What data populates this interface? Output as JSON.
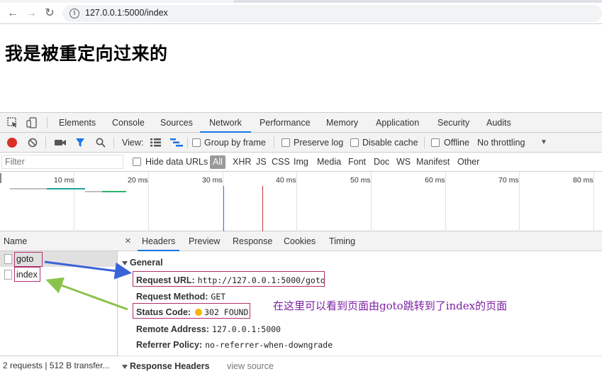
{
  "browser": {
    "url": "127.0.0.1:5000/index",
    "back_icon": "arrow-left-icon",
    "forward_icon": "arrow-right-icon",
    "reload_icon": "reload-icon",
    "info_icon": "info-icon"
  },
  "page": {
    "heading": "我是被重定向过来的"
  },
  "devtools": {
    "tabs": [
      "Elements",
      "Console",
      "Sources",
      "Network",
      "Performance",
      "Memory",
      "Application",
      "Security",
      "Audits"
    ],
    "active_tab": "Network",
    "toolbar": {
      "view_label": "View:",
      "group_by_frame": "Group by frame",
      "preserve_log": "Preserve log",
      "disable_cache": "Disable cache",
      "offline": "Offline",
      "throttling": "No throttling"
    },
    "filter": {
      "placeholder": "Filter",
      "hide_data_urls": "Hide data URLs",
      "types": [
        "All",
        "XHR",
        "JS",
        "CSS",
        "Img",
        "Media",
        "Font",
        "Doc",
        "WS",
        "Manifest",
        "Other"
      ]
    },
    "timeline": {
      "ticks": [
        "10 ms",
        "20 ms",
        "30 ms",
        "40 ms",
        "50 ms",
        "60 ms",
        "70 ms",
        "80 ms"
      ],
      "colors": {
        "dom_content_loaded": "#3b7ed6",
        "load": "#c0392b",
        "bar_gray": "#bfbfbf",
        "bar_green": "#2fb36a",
        "bar_teal": "#1fa39a"
      }
    },
    "requests": {
      "header": "Name",
      "rows": [
        "goto",
        "index"
      ],
      "footer": "2 requests  |  512 B transfer..."
    },
    "detail": {
      "close": "×",
      "tabs": [
        "Headers",
        "Preview",
        "Response",
        "Cookies",
        "Timing"
      ],
      "active_tab": "Headers",
      "general_title": "General",
      "general": [
        {
          "key": "Request URL:",
          "value": "http://127.0.0.1:5000/goto"
        },
        {
          "key": "Request Method:",
          "value": "GET"
        },
        {
          "key": "Status Code:",
          "value": "302 FOUND"
        },
        {
          "key": "Remote Address:",
          "value": "127.0.0.1:5000"
        },
        {
          "key": "Referrer Policy:",
          "value": "no-referrer-when-downgrade"
        }
      ],
      "response_headers_title": "Response Headers",
      "view_source": "view source"
    }
  },
  "annotation": {
    "text": "在这里可以看到页面由goto跳转到了index的页面",
    "color": "#7b1fa2",
    "highlight_color": "#b0306a",
    "arrow_blue": "#3a63d6",
    "arrow_green": "#8bc34a"
  }
}
